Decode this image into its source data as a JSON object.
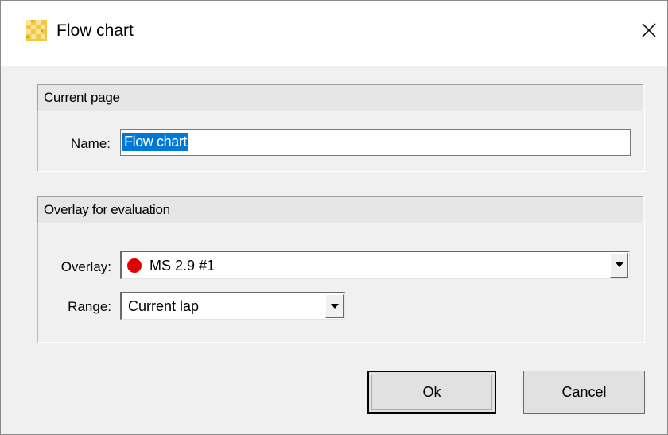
{
  "window": {
    "title": "Flow chart",
    "app_icon": "flag-icon",
    "close_icon": "close-icon"
  },
  "current_page": {
    "header": "Current page",
    "name_label": "Name:",
    "name_value": "Flow chart"
  },
  "overlay": {
    "header": "Overlay for evaluation",
    "overlay_label": "Overlay:",
    "overlay_value": "MS 2.9 #1",
    "overlay_indicator_color": "#e00000",
    "range_label": "Range:",
    "range_value": "Current lap"
  },
  "buttons": {
    "ok_mnemonic": "O",
    "ok_rest": "k",
    "cancel_mnemonic": "C",
    "cancel_rest": "ancel"
  },
  "colors": {
    "selection_bg": "#0078d7",
    "selection_fg": "#ffffff"
  }
}
